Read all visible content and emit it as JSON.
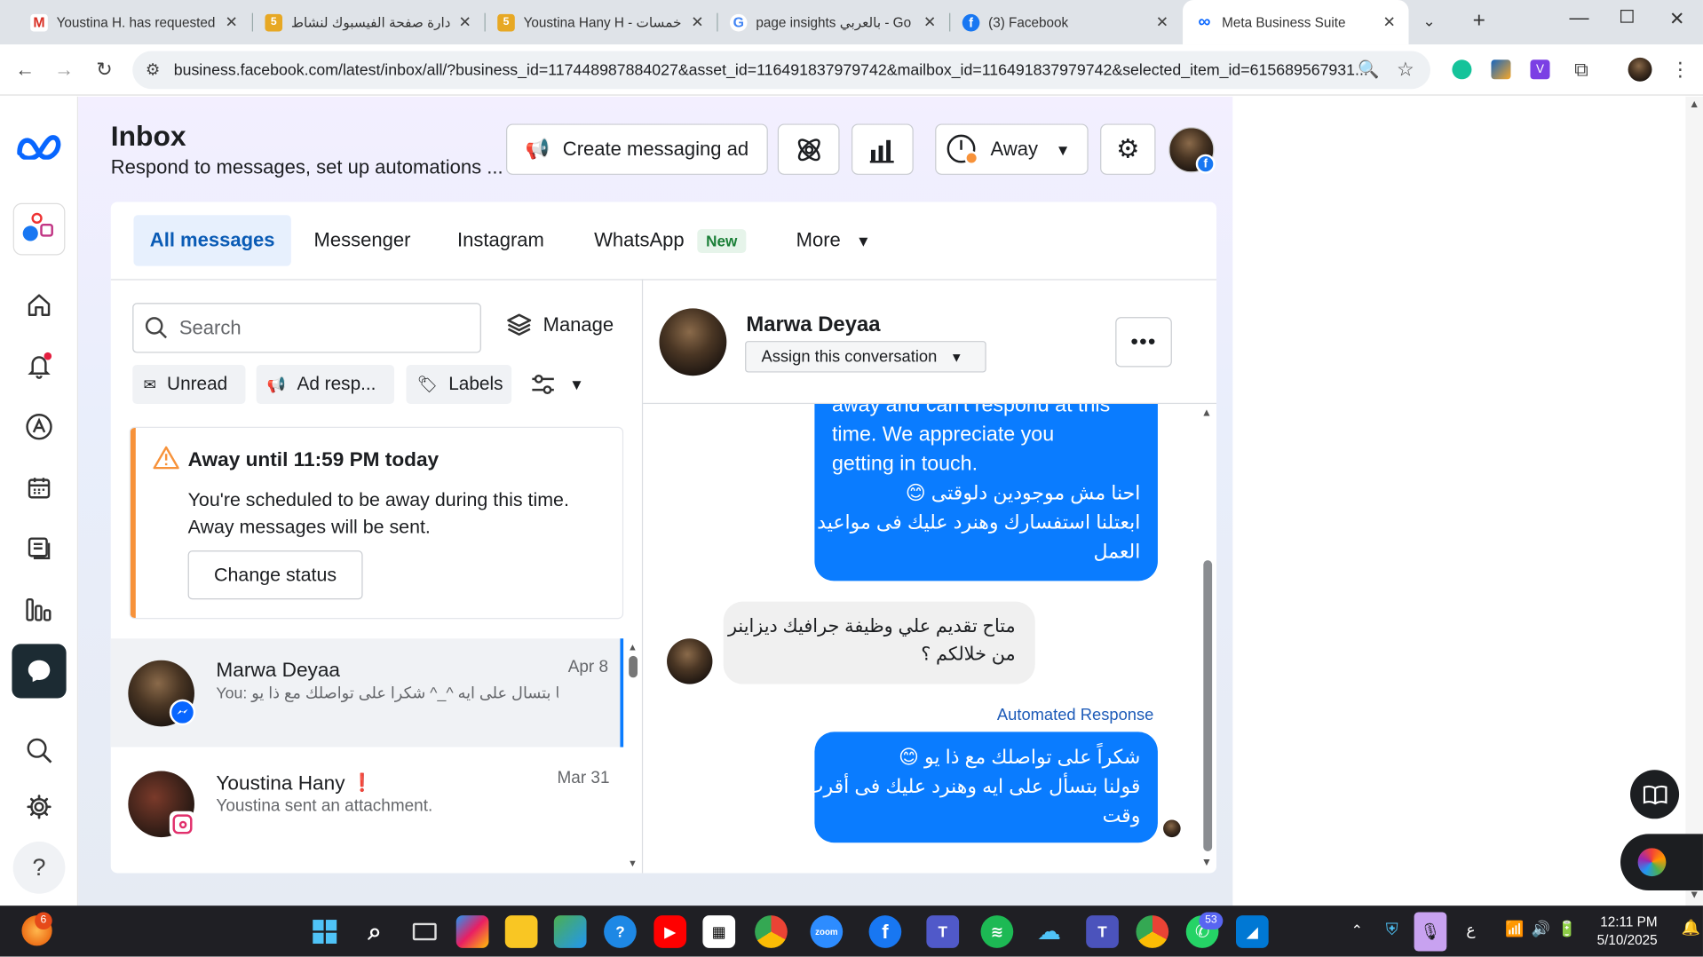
{
  "browser": {
    "tabs": [
      {
        "title": "Youstina H. has requested",
        "icon": "gmail-icon",
        "color": "#d93025",
        "glyph": "M"
      },
      {
        "title": "ادارة صفحة الفيسبوك لنشاط",
        "icon": "khamsat-icon",
        "color": "#e7a824",
        "glyph": "5"
      },
      {
        "title": "Youstina Hany H - خمسات.",
        "icon": "khamsat-icon",
        "color": "#e7a824",
        "glyph": "5"
      },
      {
        "title": "page insights بالعربي - Go",
        "icon": "google-icon",
        "color": "#4285f4",
        "glyph": "G"
      },
      {
        "title": "(3) Facebook",
        "icon": "facebook-icon",
        "color": "#1877f2",
        "glyph": "f"
      },
      {
        "title": "Meta Business Suite",
        "icon": "meta-icon",
        "color": "#0866ff",
        "glyph": "∞"
      }
    ],
    "url": "business.facebook.com/latest/inbox/all/?business_id=117448987884027&asset_id=116491837979742&mailbox_id=116491837979742&selected_item_id=615689567931..."
  },
  "header": {
    "title": "Inbox",
    "subtitle": "Respond to messages, set up automations ...",
    "create_ad_label": "Create messaging ad",
    "status_label": "Away"
  },
  "filters": {
    "tabs": [
      "All messages",
      "Messenger",
      "Instagram",
      "WhatsApp",
      "More"
    ],
    "new_badge": "New"
  },
  "list": {
    "search_placeholder": "Search",
    "manage_label": "Manage",
    "chips": [
      "Unread",
      "Ad resp...",
      "Labels"
    ],
    "away": {
      "title": "Away until 11:59 PM today",
      "body_line1": "You're scheduled to be away during this time.",
      "body_line2": "Away messages will be sent.",
      "button": "Change status"
    },
    "conversations": [
      {
        "name": "Marwa Deyaa",
        "date": "Apr 8",
        "preview": "You: قولنا بتسأل على ايه ^_^ شكراً على تواصلك مع ذا يو",
        "channel": "messenger"
      },
      {
        "name": "Youstina Hany",
        "date": "Mar 31",
        "preview": "Youstina sent an attachment.",
        "flag": "❗",
        "channel": "instagram"
      }
    ]
  },
  "chat": {
    "name": "Marwa Deyaa",
    "assign_label": "Assign this conversation",
    "out_message_1": [
      "away and can't respond at this",
      "time. We appreciate you",
      "getting in touch.",
      "احنا مش موجودين دلوقتى 😊",
      "ابعتلنا استفسارك وهنرد عليك فى مواعيد",
      "العمل"
    ],
    "in_message": [
      "متاح تقديم علي وظيفة جرافيك ديزاينر",
      "من خلالكم ؟"
    ],
    "automated_label": "Automated Response",
    "out_message_2": [
      "شكراً على تواصلك مع ذا يو 😊",
      "قولنا بتسأل على ايه وهنرد عليك فى أقرب",
      "وقت"
    ]
  },
  "taskbar": {
    "notif_count": "6",
    "whatsapp_count": "53",
    "lang": "ع",
    "time": "12:11 PM",
    "date": "5/10/2025"
  },
  "colors": {
    "accent": "#0a7cff",
    "meta_blue": "#0866ff",
    "active_tab_bg": "#e7f0fd",
    "away_bar": "#f7923a"
  }
}
